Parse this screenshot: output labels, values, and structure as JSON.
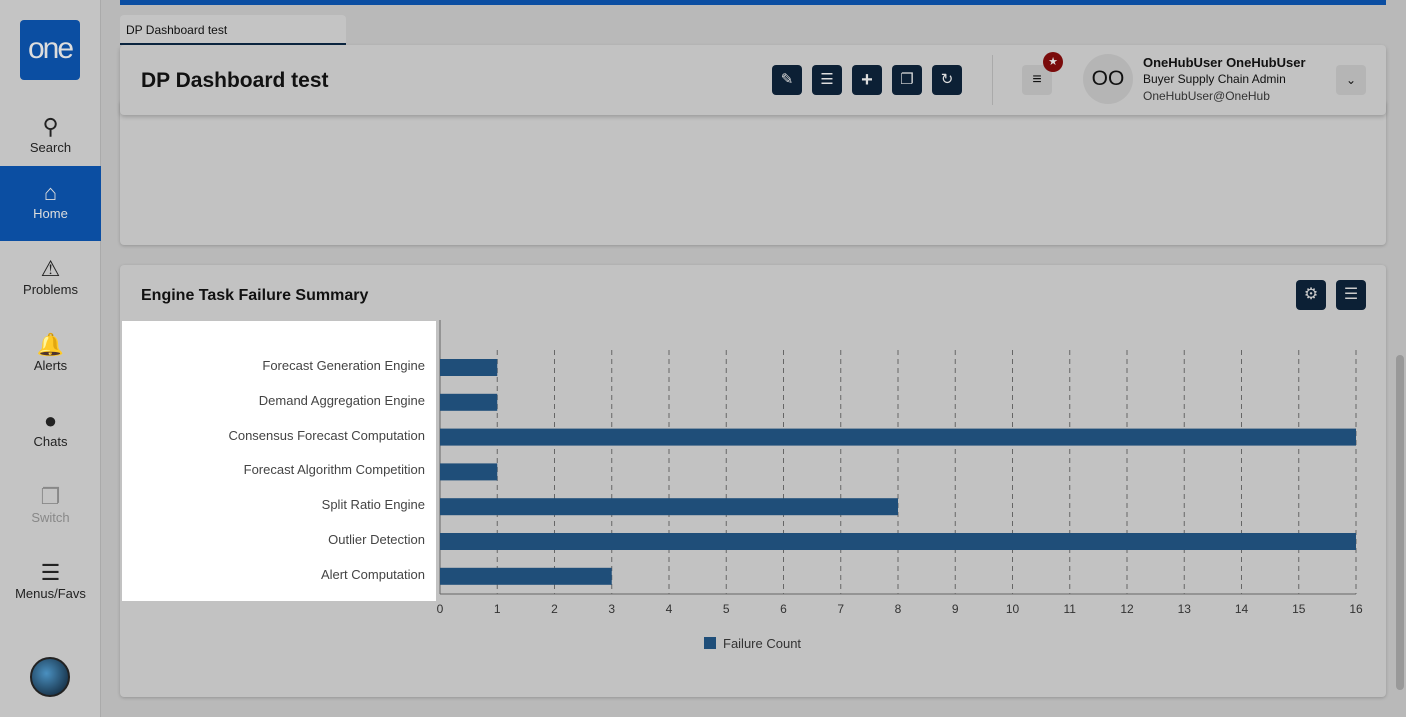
{
  "sidebar": {
    "logo": "one",
    "items": [
      {
        "label": "Search",
        "icon": "search-icon"
      },
      {
        "label": "Home",
        "icon": "home-icon",
        "active": true
      },
      {
        "label": "Problems",
        "icon": "warning-icon"
      },
      {
        "label": "Alerts",
        "icon": "bell-icon"
      },
      {
        "label": "Chats",
        "icon": "chat-icon"
      },
      {
        "label": "Switch",
        "icon": "switch-icon",
        "disabled": true
      },
      {
        "label": "Menus/Favs",
        "icon": "menu-icon"
      }
    ]
  },
  "tab": {
    "label": "DP Dashboard test"
  },
  "header": {
    "title": "DP Dashboard test",
    "user": {
      "initials": "OO",
      "name": "OneHubUser OneHubUser",
      "role": "Buyer Supply Chain Admin",
      "email": "OneHubUser@OneHub"
    }
  },
  "widget": {
    "title": "Engine Task Failure Summary"
  },
  "chart_data": {
    "type": "bar",
    "orientation": "horizontal",
    "categories": [
      "Forecast Generation Engine",
      "Demand Aggregation Engine",
      "Consensus Forecast Computation",
      "Forecast Algorithm Competition",
      "Split Ratio Engine",
      "Outlier Detection",
      "Alert Computation"
    ],
    "series": [
      {
        "name": "Failure Count",
        "values": [
          1,
          1,
          16,
          1,
          8,
          16,
          3
        ],
        "color": "#1f4e79"
      }
    ],
    "xlim": [
      0,
      16
    ],
    "xticks": [
      "0",
      "1",
      "2",
      "3",
      "4",
      "5",
      "6",
      "7",
      "8",
      "9",
      "10",
      "11",
      "12",
      "13",
      "14",
      "15",
      "16"
    ],
    "grid": true,
    "legend": "bottom"
  }
}
